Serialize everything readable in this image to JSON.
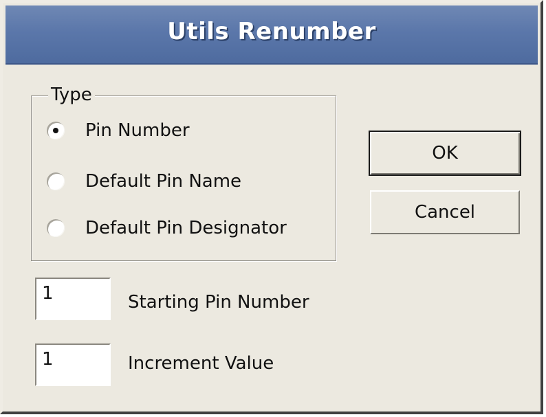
{
  "window": {
    "title": "Utils Renumber"
  },
  "type_group": {
    "legend": "Type",
    "options": [
      {
        "label": "Pin Number",
        "selected": true
      },
      {
        "label": "Default Pin Name",
        "selected": false
      },
      {
        "label": "Default Pin Designator",
        "selected": false
      }
    ]
  },
  "buttons": {
    "ok_label": "OK",
    "cancel_label": "Cancel"
  },
  "fields": {
    "starting_pin_number": {
      "value": "1",
      "label": "Starting Pin Number"
    },
    "increment_value": {
      "value": "1",
      "label": "Increment Value"
    }
  },
  "colors": {
    "titlebar": "#5b77aa",
    "dialog_bg": "#ece9e0"
  }
}
